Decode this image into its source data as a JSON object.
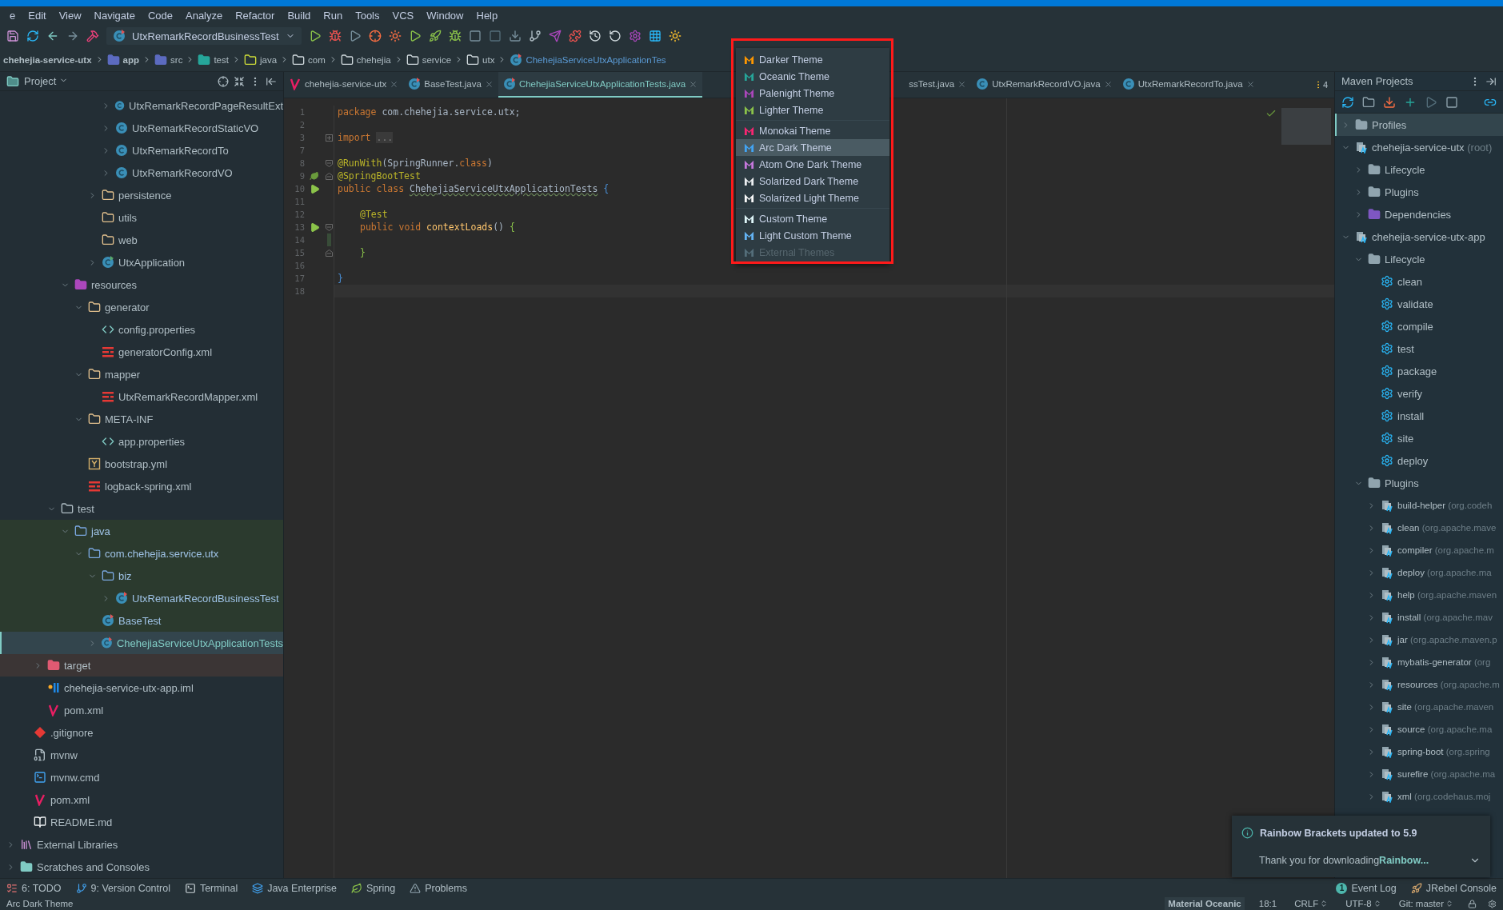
{
  "menu_bar": {
    "items": [
      "e",
      "Edit",
      "View",
      "Navigate",
      "Code",
      "Analyze",
      "Refactor",
      "Build",
      "Run",
      "Tools",
      "VCS",
      "Window",
      "Help"
    ]
  },
  "toolbar": {
    "run_config": "UtxRemarkRecordBusinessTest"
  },
  "breadcrumbs": [
    {
      "label": "chehejia-service-utx",
      "kind": "project"
    },
    {
      "label": "app",
      "kind": "module"
    },
    {
      "label": "src",
      "kind": "module"
    },
    {
      "label": "test",
      "kind": "test"
    },
    {
      "label": "java",
      "kind": "folder"
    },
    {
      "label": "com",
      "kind": "package"
    },
    {
      "label": "chehejia",
      "kind": "package"
    },
    {
      "label": "service",
      "kind": "package"
    },
    {
      "label": "utx",
      "kind": "package"
    },
    {
      "label": "ChehejiaServiceUtxApplicationTes",
      "kind": "class"
    }
  ],
  "project_panel": {
    "title": "Project",
    "tree": [
      {
        "children": [
          {
            "children": [
              {
                "children": [
                  {
                    "children": [
                      {
                        "children": [
                          {
                            "children": [
                              {
                                "children": [
                                  {
                                    "label": "UtxRemarkRecordPageResultExt",
                                    "kind": "class",
                                    "expanded": false,
                                    "selected": false
                                  },
                                  {
                                    "label": "UtxRemarkRecordStaticVO",
                                    "kind": "class",
                                    "expanded": false,
                                    "selected": false
                                  },
                                  {
                                    "label": "UtxRemarkRecordTo",
                                    "kind": "class",
                                    "expanded": false,
                                    "selected": false
                                  },
                                  {
                                    "label": "UtxRemarkRecordVO",
                                    "kind": "class",
                                    "expanded": false,
                                    "selected": false
                                  }
                                ]
                              },
                              {
                                "label": "persistence",
                                "kind": "package",
                                "expanded": false,
                                "selected": false
                              },
                              {
                                "label": "utils",
                                "kind": "package",
                                "selected": false
                              },
                              {
                                "label": "web",
                                "kind": "package",
                                "selected": false
                              },
                              {
                                "label": "UtxApplication",
                                "kind": "app",
                                "expanded": false,
                                "selected": false
                              }
                            ]
                          }
                        ]
                      },
                      {
                        "label": "resources",
                        "kind": "resources",
                        "expanded": true,
                        "selected": false,
                        "children": [
                          {
                            "label": "generator",
                            "kind": "package",
                            "expanded": true,
                            "selected": false,
                            "children": [
                              {
                                "label": "config.properties",
                                "kind": "properties",
                                "selected": false
                              },
                              {
                                "label": "generatorConfig.xml",
                                "kind": "xml",
                                "selected": false
                              }
                            ]
                          },
                          {
                            "label": "mapper",
                            "kind": "package",
                            "expanded": true,
                            "selected": false,
                            "children": [
                              {
                                "label": "UtxRemarkRecordMapper.xml",
                                "kind": "xml",
                                "selected": false
                              }
                            ]
                          },
                          {
                            "label": "META-INF",
                            "kind": "package",
                            "expanded": true,
                            "selected": false,
                            "children": [
                              {
                                "label": "app.properties",
                                "kind": "properties",
                                "selected": false
                              }
                            ]
                          },
                          {
                            "label": "bootstrap.yml",
                            "kind": "yaml",
                            "selected": false
                          },
                          {
                            "label": "logback-spring.xml",
                            "kind": "xml",
                            "selected": false
                          }
                        ]
                      }
                    ]
                  },
                  {
                    "label": "test",
                    "kind": "folder",
                    "expanded": true,
                    "selected": false,
                    "children": [
                      {
                        "label": "java",
                        "kind": "testroot",
                        "expanded": true,
                        "selected": false,
                        "in_test_scope": true,
                        "children": [
                          {
                            "label": "com.chehejia.service.utx",
                            "kind": "testroot",
                            "expanded": true,
                            "selected": false,
                            "in_test_scope": true,
                            "children": [
                              {
                                "label": "biz",
                                "kind": "testroot",
                                "expanded": true,
                                "selected": false,
                                "in_test_scope": true,
                                "children": [
                                  {
                                    "label": "UtxRemarkRecordBusinessTest",
                                    "kind": "testclass",
                                    "expanded": false,
                                    "selected": false,
                                    "in_test_scope": true
                                  }
                                ]
                              },
                              {
                                "label": "BaseTest",
                                "kind": "testclass",
                                "selected": false,
                                "in_test_scope": true
                              },
                              {
                                "label": "ChehejiaServiceUtxApplicationTests",
                                "kind": "testclass",
                                "expanded": false,
                                "selected": true
                              }
                            ]
                          }
                        ]
                      }
                    ]
                  }
                ]
              },
              {
                "label": "target",
                "kind": "excluded",
                "expanded": false,
                "selected": false,
                "excluded": true
              },
              {
                "label": "chehejia-service-utx-app.iml",
                "kind": "iml",
                "selected": false
              },
              {
                "label": "pom.xml",
                "kind": "maven",
                "selected": false
              }
            ]
          },
          {
            "label": ".gitignore",
            "kind": "git",
            "selected": false
          },
          {
            "label": "mvnw",
            "kind": "binary",
            "selected": false
          },
          {
            "label": "mvnw.cmd",
            "kind": "cmd",
            "selected": false
          },
          {
            "label": "pom.xml",
            "kind": "maven",
            "selected": false
          },
          {
            "label": "README.md",
            "kind": "markdown",
            "selected": false
          }
        ]
      },
      {
        "label": "External Libraries",
        "kind": "library",
        "expanded": false,
        "selected": false
      },
      {
        "label": "Scratches and Consoles",
        "kind": "scratches",
        "expanded": false,
        "selected": false
      }
    ]
  },
  "editor": {
    "tabs": [
      {
        "label": "chehejia-service-utx",
        "kind": "maven",
        "selected": false
      },
      {
        "label": "BaseTest.java",
        "kind": "testclass",
        "selected": false
      },
      {
        "label": "ChehejiaServiceUtxApplicationTests.java",
        "kind": "testclass",
        "selected": true
      },
      {
        "label": "ssTest.java",
        "kind": "partial",
        "selected": false
      },
      {
        "label": "UtxRemarkRecordVO.java",
        "kind": "class",
        "selected": false
      },
      {
        "label": "UtxRemarkRecordTo.java",
        "kind": "class",
        "selected": false
      }
    ],
    "hidden_tab_count": "4",
    "lines": [
      {
        "number": "1",
        "kind": "top",
        "current": false,
        "tokens": [
          {
            "kind": "keyword",
            "text": "package "
          },
          {
            "kind": "plain",
            "text": "com.chehejia.service.utx;"
          }
        ]
      },
      {
        "number": "2",
        "kind": "top",
        "current": false
      },
      {
        "number": "3",
        "kind": "top",
        "current": false,
        "fold": {
          "kind": "collapsed"
        },
        "tokens": [
          {
            "kind": "keyword",
            "text": "import "
          },
          {
            "kind": "folded",
            "text": "..."
          }
        ]
      },
      {
        "number": "7",
        "kind": "top",
        "current": false
      },
      {
        "number": "8",
        "kind": "top",
        "current": false,
        "fold": {
          "kind": "open"
        },
        "tokens": [
          {
            "kind": "annotation",
            "text": "@RunWith"
          },
          {
            "kind": "plain",
            "text": "(SpringRunner."
          },
          {
            "kind": "keyword",
            "text": "class"
          },
          {
            "kind": "plain",
            "text": ")"
          }
        ]
      },
      {
        "number": "9",
        "kind": "top",
        "current": false,
        "gutter": {
          "kind": "spring"
        },
        "fold": {
          "kind": "close"
        },
        "tokens": [
          {
            "kind": "annotation",
            "text": "@SpringBootTest"
          }
        ]
      },
      {
        "number": "10",
        "kind": "top",
        "current": false,
        "gutter": {
          "kind": "run_all"
        },
        "tokens": [
          {
            "kind": "keyword",
            "text": "public class "
          },
          {
            "kind": "typo",
            "text": "ChehejiaServiceUtxApplicationTests"
          },
          {
            "kind": "brace_outer",
            "text": " {"
          }
        ]
      },
      {
        "number": "11",
        "kind": "top",
        "current": false
      },
      {
        "number": "12",
        "kind": "member",
        "current": false,
        "tokens": [
          {
            "kind": "annotation",
            "text": "@Test"
          }
        ]
      },
      {
        "number": "13",
        "kind": "member",
        "current": false,
        "gutter": {
          "kind": "run"
        },
        "fold": {
          "kind": "open"
        },
        "tokens": [
          {
            "kind": "keyword",
            "text": "public void "
          },
          {
            "kind": "method",
            "text": "contextLoads"
          },
          {
            "kind": "plain",
            "text": "()"
          },
          {
            "kind": "brace_inner",
            "text": " {"
          }
        ]
      },
      {
        "number": "14",
        "kind": "member",
        "current": false,
        "changed": true
      },
      {
        "number": "15",
        "kind": "member",
        "current": false,
        "fold": {
          "kind": "close"
        },
        "tokens": [
          {
            "kind": "brace_inner",
            "text": "}"
          }
        ]
      },
      {
        "number": "16",
        "kind": "top",
        "current": false
      },
      {
        "number": "17",
        "kind": "top",
        "current": false,
        "tokens": [
          {
            "kind": "brace_outer",
            "text": "}"
          }
        ]
      },
      {
        "number": "18",
        "kind": "top",
        "current": true
      }
    ]
  },
  "theme_menu": {
    "sections": [
      {
        "items": [
          {
            "label": "Darker Theme",
            "color": "#ff9800",
            "selected": false,
            "disabled": false
          },
          {
            "label": "Oceanic Theme",
            "color": "#26a69a",
            "selected": false,
            "disabled": false
          },
          {
            "label": "Palenight Theme",
            "color": "#ab47bc",
            "selected": false,
            "disabled": false
          },
          {
            "label": "Lighter Theme",
            "color": "#8bc34a",
            "selected": false,
            "disabled": false
          }
        ]
      },
      {
        "items": [
          {
            "label": "Monokai Theme",
            "color": "#f92672",
            "selected": false,
            "disabled": false
          },
          {
            "label": "Arc Dark Theme",
            "color": "#42a5f5",
            "selected": true,
            "disabled": false
          },
          {
            "label": "Atom One Dark Theme",
            "color": "#c678dd",
            "selected": false,
            "disabled": false
          },
          {
            "label": "Solarized Dark Theme",
            "color": "#eceff1",
            "selected": false,
            "disabled": false
          },
          {
            "label": "Solarized Light Theme",
            "color": "#fafafa",
            "selected": false,
            "disabled": false
          }
        ]
      },
      {
        "items": [
          {
            "label": "Custom Theme",
            "color": "#e0f7fa",
            "selected": false,
            "disabled": false
          },
          {
            "label": "Light Custom Theme",
            "color": "#64b5f6",
            "selected": false,
            "disabled": false
          },
          {
            "label": "External Themes",
            "color": "#546e7a",
            "selected": false,
            "disabled": true
          }
        ]
      }
    ]
  },
  "maven_panel": {
    "title": "Maven Projects",
    "tree": [
      {
        "label": "Profiles",
        "kind": "profiles",
        "expanded": false,
        "selected": true
      },
      {
        "label": "chehejia-service-utx",
        "note": "(root)",
        "kind": "module",
        "expanded": true,
        "selected": false,
        "children": [
          {
            "label": "Lifecycle",
            "kind": "group",
            "expanded": false,
            "selected": false
          },
          {
            "label": "Plugins",
            "kind": "group",
            "expanded": false,
            "selected": false
          },
          {
            "label": "Dependencies",
            "kind": "dependencies",
            "expanded": false,
            "selected": false
          }
        ]
      },
      {
        "label": "chehejia-service-utx-app",
        "kind": "module",
        "expanded": true,
        "selected": false,
        "children": [
          {
            "label": "Lifecycle",
            "kind": "group",
            "expanded": true,
            "selected": false,
            "children": [
              {
                "label": "clean",
                "kind": "goal",
                "selected": false
              },
              {
                "label": "validate",
                "kind": "goal",
                "selected": false
              },
              {
                "label": "compile",
                "kind": "goal",
                "selected": false
              },
              {
                "label": "test",
                "kind": "goal",
                "selected": false
              },
              {
                "label": "package",
                "kind": "goal",
                "selected": false
              },
              {
                "label": "verify",
                "kind": "goal",
                "selected": false
              },
              {
                "label": "install",
                "kind": "goal",
                "selected": false
              },
              {
                "label": "site",
                "kind": "goal",
                "selected": false
              },
              {
                "label": "deploy",
                "kind": "goal",
                "selected": false
              }
            ]
          },
          {
            "label": "Plugins",
            "kind": "group",
            "expanded": true,
            "selected": false,
            "children": [
              {
                "label": "build-helper",
                "note": "(org.codeh",
                "kind": "plugin",
                "expanded": false,
                "selected": false
              },
              {
                "label": "clean",
                "note": "(org.apache.mave",
                "kind": "plugin",
                "expanded": false,
                "selected": false
              },
              {
                "label": "compiler",
                "note": "(org.apache.m",
                "kind": "plugin",
                "expanded": false,
                "selected": false
              },
              {
                "label": "deploy",
                "note": "(org.apache.ma",
                "kind": "plugin",
                "expanded": false,
                "selected": false
              },
              {
                "label": "help",
                "note": "(org.apache.maven",
                "kind": "plugin",
                "expanded": false,
                "selected": false
              },
              {
                "label": "install",
                "note": "(org.apache.mav",
                "kind": "plugin",
                "expanded": false,
                "selected": false
              },
              {
                "label": "jar",
                "note": "(org.apache.maven.p",
                "kind": "plugin",
                "expanded": false,
                "selected": false
              },
              {
                "label": "mybatis-generator",
                "note": "(org",
                "kind": "plugin",
                "expanded": false,
                "selected": false
              },
              {
                "label": "resources",
                "note": "(org.apache.m",
                "kind": "plugin",
                "expanded": false,
                "selected": false
              },
              {
                "label": "site",
                "note": "(org.apache.maven",
                "kind": "plugin",
                "expanded": false,
                "selected": false
              },
              {
                "label": "source",
                "note": "(org.apache.ma",
                "kind": "plugin",
                "expanded": false,
                "selected": false
              },
              {
                "label": "spring-boot",
                "note": "(org.spring",
                "kind": "plugin",
                "expanded": false,
                "selected": false
              },
              {
                "label": "surefire",
                "note": "(org.apache.ma",
                "kind": "plugin",
                "expanded": false,
                "selected": false
              },
              {
                "label": "xml",
                "note": "(org.codehaus.moj",
                "kind": "plugin",
                "expanded": false,
                "selected": false
              }
            ]
          }
        ]
      }
    ]
  },
  "notification": {
    "title": "Rainbow Brackets updated to 5.9",
    "body": "Thank you for downloading**Rainbow...**"
  },
  "tool_windows": {
    "left": [
      {
        "label": "6: TODO",
        "kind": "todo"
      },
      {
        "label": "9: Version Control",
        "kind": "vcs"
      },
      {
        "label": "Terminal",
        "kind": "terminal"
      },
      {
        "label": "Java Enterprise",
        "kind": "enterprise"
      },
      {
        "label": "Spring",
        "kind": "spring"
      },
      {
        "label": "Problems",
        "kind": "problems"
      }
    ],
    "right": [
      {
        "label": "Event Log",
        "kind": "events",
        "badge": "1"
      },
      {
        "label": "JRebel Console",
        "kind": "jrebel"
      }
    ]
  },
  "status_bar": {
    "message": "Arc Dark Theme",
    "items": [
      {
        "label": "Material Oceanic",
        "kind": "theme"
      },
      {
        "label": "18:1",
        "kind": "text"
      },
      {
        "label": "CRLF",
        "kind": "menu"
      },
      {
        "label": "UTF-8",
        "kind": "menu"
      },
      {
        "label": "Git: master",
        "kind": "menu"
      }
    ]
  }
}
